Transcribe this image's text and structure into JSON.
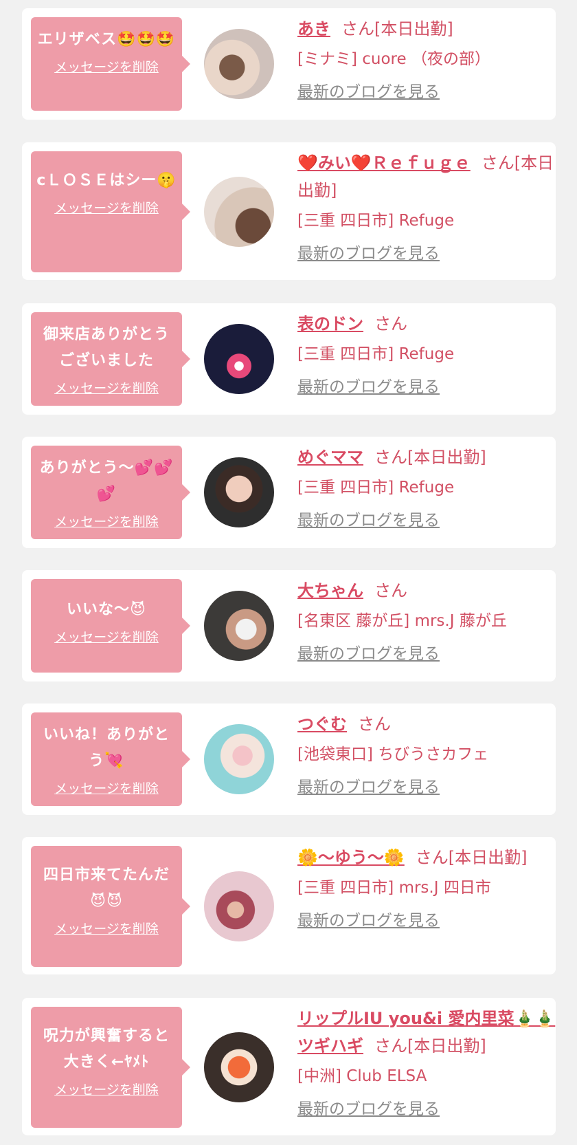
{
  "delete_label": "メッセージを削除",
  "blog_label": "最新のブログを見る",
  "items": [
    {
      "message": "エリザベス🤩🤩🤩",
      "name": "あき",
      "suffix": "さん[本日出勤]",
      "shop": "[ミナミ] cuore （夜の部）"
    },
    {
      "message": "cＬＯＳＥはシー🤫",
      "name": "❤️みい❤️Ｒｅｆｕｇｅ",
      "suffix": "さん[本日出勤]",
      "shop": "[三重 四日市] Refuge"
    },
    {
      "message": "御来店ありがとうございました",
      "name": "表のドン",
      "suffix": "さん",
      "shop": "[三重 四日市] Refuge"
    },
    {
      "message": "ありがとう〜💕💕💕",
      "name": "めぐママ",
      "suffix": "さん[本日出勤]",
      "shop": "[三重 四日市] Refuge"
    },
    {
      "message": "いいな〜😈",
      "name": "大ちゃん",
      "suffix": "さん",
      "shop": "[名東区 藤が丘] mrs.J 藤が丘"
    },
    {
      "message": "いいね！ありがとう💘",
      "name": "つぐむ",
      "suffix": "さん",
      "shop": "[池袋東口] ちびうさカフェ"
    },
    {
      "message": "四日市来てたんだ😈😈",
      "name": "🌼〜ゆう〜🌼",
      "suffix": "さん[本日出勤]",
      "shop": "[三重 四日市] mrs.J 四日市"
    },
    {
      "message": "呪力が興奮すると大きく←ﾔﾒﾄ",
      "name": "リップルIU you&i 愛内里菜🎍🎍ツギハギ",
      "suffix": "さん[本日出勤]",
      "shop": "[中洲] Club ELSA"
    }
  ],
  "colors": {
    "bubble": "#ee9ca8",
    "name": "#d94a62",
    "text": "#d25064",
    "link_gray": "#8a8a8a",
    "background": "#f1f1f1"
  }
}
